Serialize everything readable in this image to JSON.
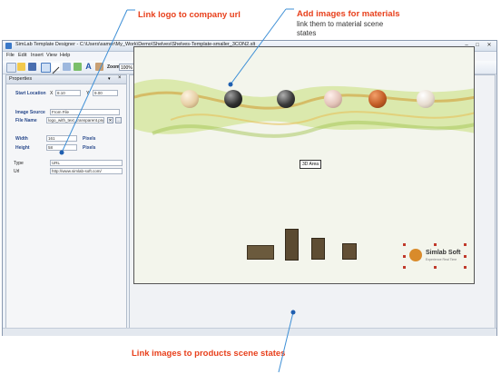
{
  "callouts": {
    "logo": "Link logo to company url",
    "materials_title": "Add images for materials",
    "materials_sub": "link them to material scene states",
    "products": "Link images to products scene states"
  },
  "window": {
    "title": "SimLab Template Designer - C:\\Users\\samer\\My_Work\\Demo\\Shelves\\Shelves-Template-smaller_3CON2.slt",
    "controls": [
      "–",
      "□",
      "✕"
    ],
    "menu": [
      "File",
      "Edit",
      "Insert",
      "View",
      "Help"
    ],
    "toolbar": {
      "zoom_label": "Zoom",
      "zoom_value": "100%"
    }
  },
  "properties": {
    "header": "Properties",
    "start_location_label": "Start Location",
    "x_label": "X",
    "x_value": "8.10",
    "y_label": "Y",
    "y_value": "9.00",
    "image_source_label": "Image Source",
    "image_source_value": "From File",
    "file_name_label": "File Name",
    "file_name_value": "logo_with_text_transparent.png",
    "width_label": "Width",
    "width_value": "161",
    "width_unit": "Pixels",
    "height_label": "Height",
    "height_value": "58",
    "height_unit": "Pixels",
    "type_label": "Type",
    "type_value": "URL",
    "url_label": "Url",
    "url_value": "http://www.simlab-soft.com/"
  },
  "canvas": {
    "area_3d_label": "3D Area",
    "logo_text": "Simlab Soft",
    "logo_tagline": "Experience Real Time"
  },
  "colors": {
    "accent": "#e8401c",
    "callout_line": "#3d8fd6"
  }
}
